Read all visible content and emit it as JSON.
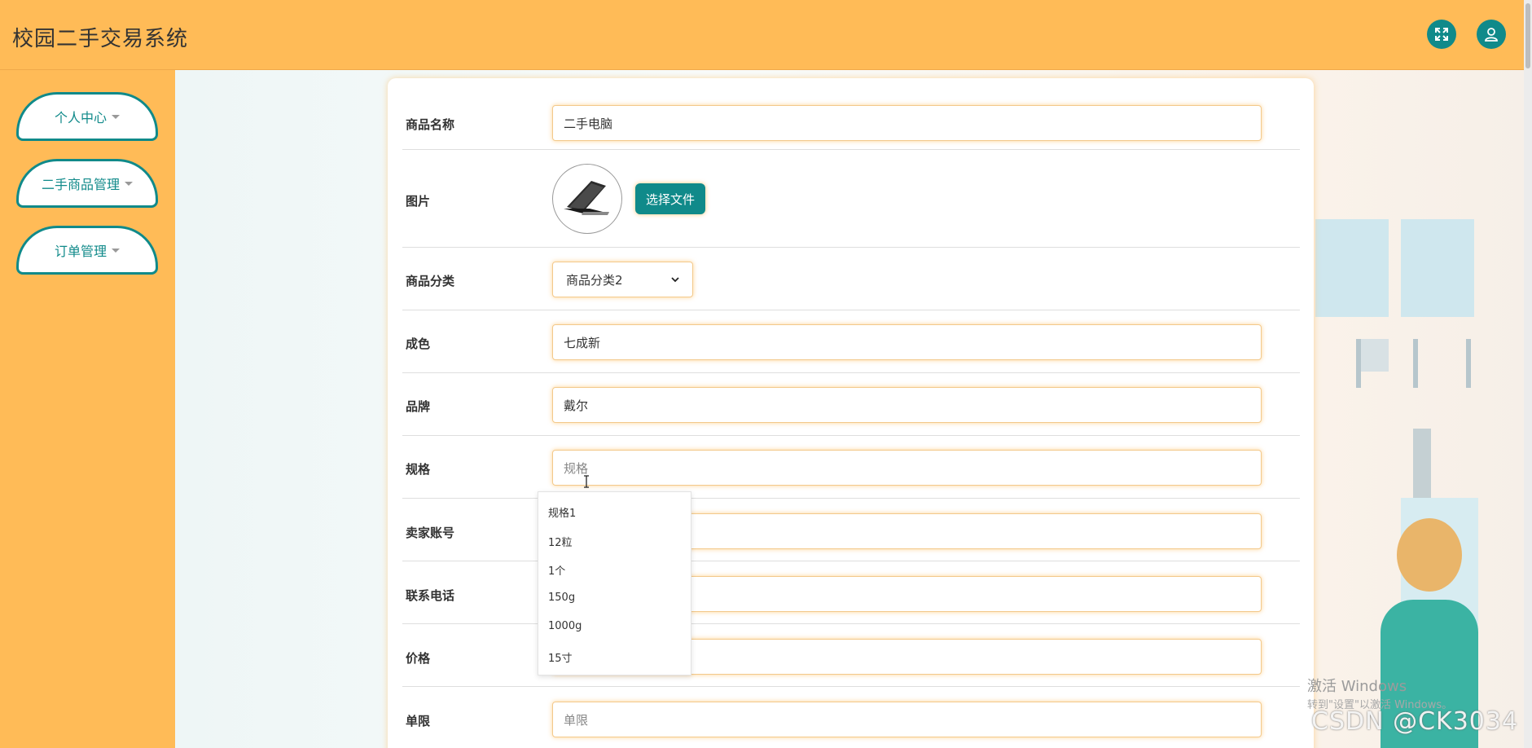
{
  "header": {
    "title": "校园二手交易系统",
    "fullscreen_icon": "expand-icon",
    "user_icon": "user-icon"
  },
  "sidebar": {
    "items": [
      {
        "label": "个人中心"
      },
      {
        "label": "二手商品管理"
      },
      {
        "label": "订单管理"
      }
    ]
  },
  "form": {
    "product_name": {
      "label": "商品名称",
      "value": "二手电脑"
    },
    "image": {
      "label": "图片",
      "button": "选择文件"
    },
    "category": {
      "label": "商品分类",
      "value": "商品分类2"
    },
    "condition": {
      "label": "成色",
      "value": "七成新"
    },
    "brand": {
      "label": "品牌",
      "value": "戴尔"
    },
    "spec": {
      "label": "规格",
      "placeholder": "规格"
    },
    "seller": {
      "label": "卖家账号"
    },
    "phone": {
      "label": "联系电话"
    },
    "price": {
      "label": "价格"
    },
    "limit": {
      "label": "单限",
      "placeholder": "单限"
    }
  },
  "spec_dropdown": {
    "options": [
      "规格1",
      "12粒",
      "1个",
      "150g",
      "1000g",
      "15寸"
    ]
  },
  "watermarks": {
    "windows_line1": "激活 Windows",
    "windows_line2": "转到\"设置\"以激活 Windows。",
    "csdn": "CSDN @CK3034"
  },
  "colors": {
    "header_bg": "#ffbb57",
    "accent": "#108a8a"
  }
}
